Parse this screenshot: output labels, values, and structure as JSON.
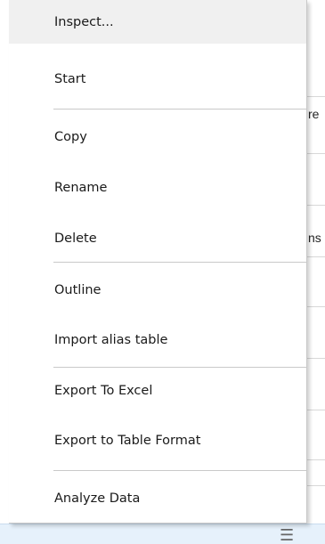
{
  "background": {
    "fragments": [
      "re",
      "ns"
    ]
  },
  "menu": {
    "items": [
      {
        "label": "Inspect..."
      },
      {
        "label": "Start"
      },
      {
        "label": "Copy"
      },
      {
        "label": "Rename"
      },
      {
        "label": "Delete"
      },
      {
        "label": "Outline"
      },
      {
        "label": "Import alias table"
      },
      {
        "label": "Export To Excel"
      },
      {
        "label": "Export to Table Format"
      },
      {
        "label": "Analyze Data"
      }
    ]
  },
  "colors": {
    "highlight": "#f0f0f0",
    "separator": "#c9c9c9",
    "status_bar": "#e6f1fb"
  },
  "icons": {
    "status_bar_menu": "hamburger-icon"
  }
}
